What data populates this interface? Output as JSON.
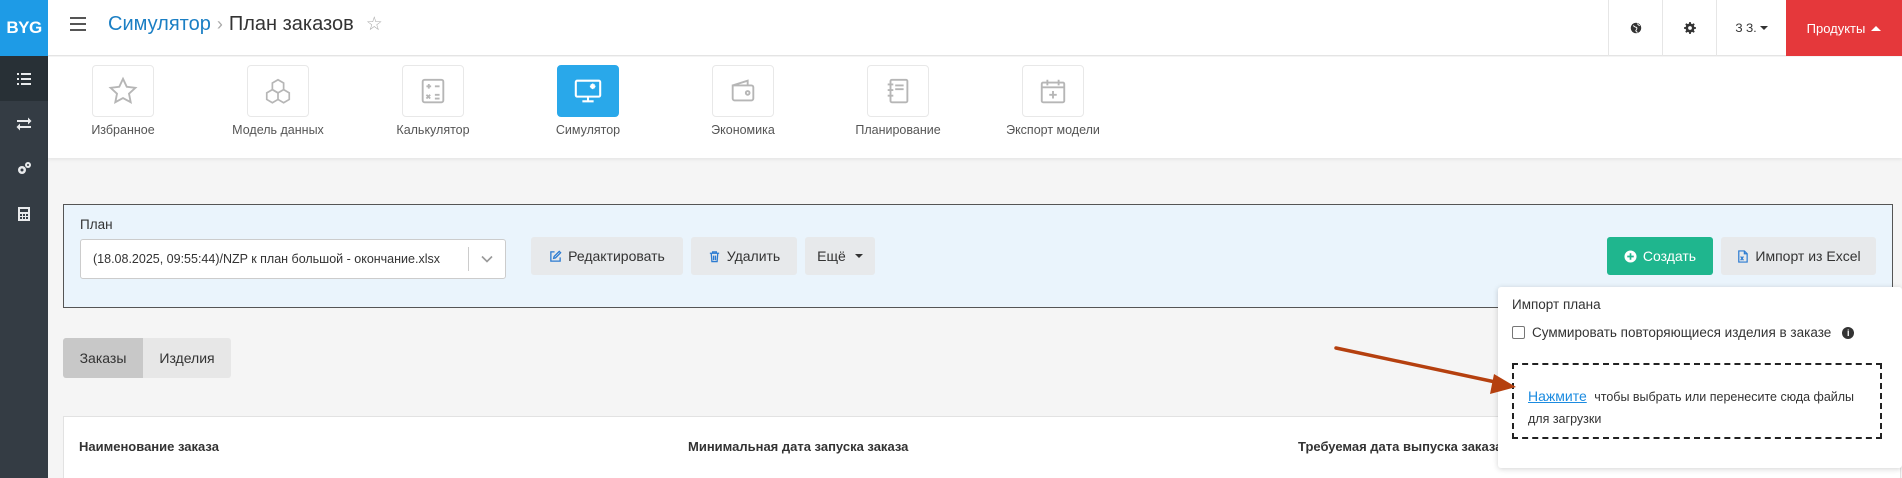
{
  "app": {
    "logo_text": "BYG"
  },
  "sidebar": {
    "items": [
      {
        "icon": "list-icon",
        "active": true
      },
      {
        "icon": "transfer-icon",
        "active": false
      },
      {
        "icon": "gears-icon",
        "active": false
      },
      {
        "icon": "calculator-icon",
        "active": false
      }
    ]
  },
  "header": {
    "breadcrumb_parent": "Симулятор",
    "breadcrumb_separator": "›",
    "page_title": "План заказов",
    "favorite_star": "☆",
    "user_label": "З З.",
    "products_label": "Продукты"
  },
  "modules": [
    {
      "label": "Избранное",
      "icon": "star-icon"
    },
    {
      "label": "Модель данных",
      "icon": "cubes-icon"
    },
    {
      "label": "Калькулятор",
      "icon": "calculator-icon"
    },
    {
      "label": "Симулятор",
      "icon": "monitor-icon",
      "active": true
    },
    {
      "label": "Экономика",
      "icon": "wallet-icon"
    },
    {
      "label": "Планирование",
      "icon": "notebook-icon"
    },
    {
      "label": "Экспорт модели",
      "icon": "calendar-plus-icon"
    }
  ],
  "plan": {
    "label": "План",
    "selected_value": "(18.08.2025, 09:55:44)/NZP к план большой - окончание.xlsx",
    "edit_label": "Редактировать",
    "delete_label": "Удалить",
    "more_label": "Ещё",
    "create_label": "Создать",
    "import_label": "Импорт из Excel"
  },
  "tabs": [
    {
      "label": "Заказы",
      "active": true
    },
    {
      "label": "Изделия",
      "active": false
    }
  ],
  "table": {
    "columns": [
      "Наименование заказа",
      "Минимальная дата запуска заказа",
      "Требуемая дата выпуска заказа"
    ]
  },
  "import_popover": {
    "title": "Импорт плана",
    "checkbox_label": "Суммировать повторяющиеся изделия в заказе",
    "checkbox_checked": false,
    "link_label": "Нажмите",
    "dropzone_text": "чтобы выбрать или перенесите сюда файлы для загрузки"
  },
  "colors": {
    "sidebar_bg": "#343c44",
    "logo_bg": "#1e9be6",
    "accent_blue": "#29a8ea",
    "products_red": "#e5383b",
    "create_green": "#1fb68e",
    "annotation_arrow": "#b5400f"
  }
}
